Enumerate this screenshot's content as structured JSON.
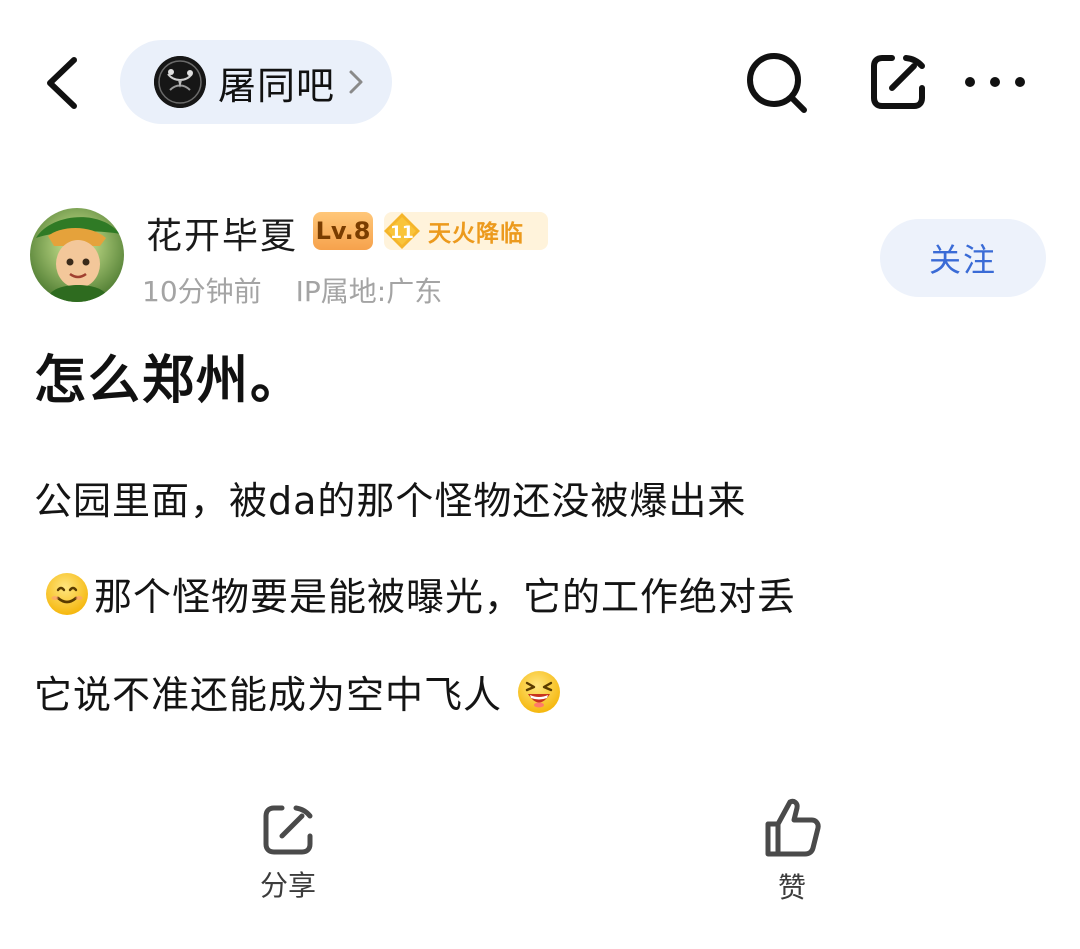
{
  "topbar": {
    "forum_name": "屠同吧",
    "icons": [
      "back-icon",
      "forum-avatar-icon",
      "chevron-right-icon",
      "search-icon",
      "edit-icon",
      "more-icon"
    ]
  },
  "author": {
    "name": "花开毕夏",
    "level": "Lv.8",
    "title_badge_number": "11",
    "title_badge": "天火降临",
    "time": "10分钟前",
    "ip": "IP属地:广东"
  },
  "follow_button": "关注",
  "post": {
    "title": "怎么郑州。",
    "line1": "公园里面，被da的那个怪物还没被爆出来",
    "line2": "那个怪物要是能被曝光，它的工作绝对丢",
    "line3": "它说不准还能成为空中飞人"
  },
  "actions": {
    "share": "分享",
    "like": "赞"
  },
  "colors": {
    "accent_blue": "#3a6bd6",
    "pill_bg": "#eaf0fa",
    "level_orange": "#f6a24c",
    "badge_gold": "#ec9a1d"
  }
}
